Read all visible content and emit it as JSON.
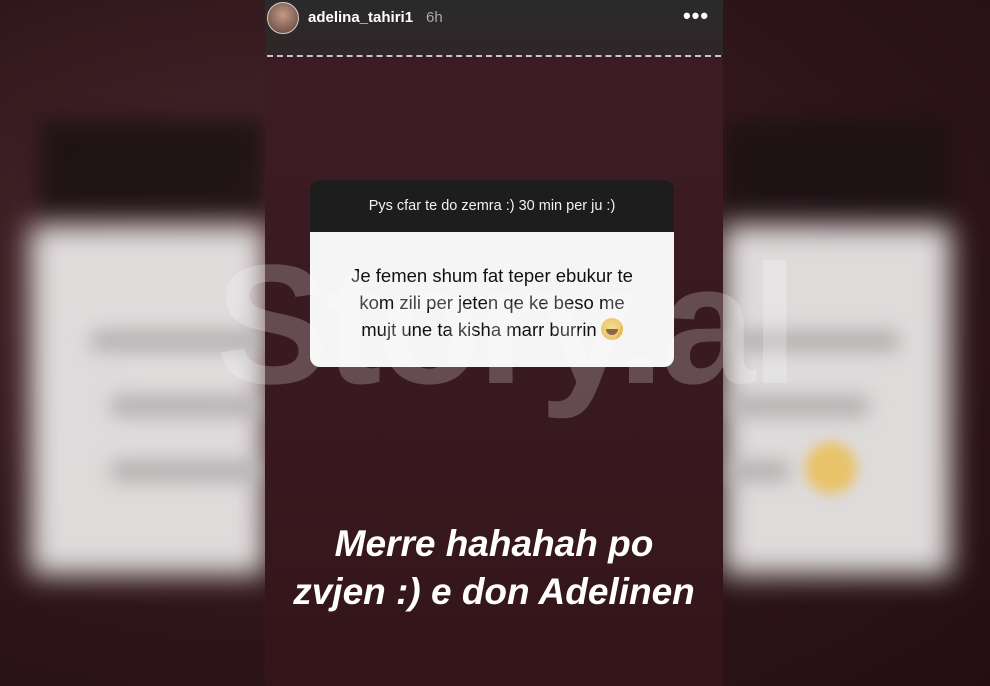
{
  "story": {
    "username": "adelina_tahiri1",
    "time": "6h",
    "more_label": "•••",
    "question": {
      "prompt": "Pys cfar te do zemra :) 30 min per ju :)",
      "answer_line1": "Je femen shum fat teper ebukur te",
      "answer_line2": "kom zili per jeten qe ke beso me",
      "answer_line3": "mujt une ta kisha marr burrin"
    },
    "reply_line1": "Merre hahahah po",
    "reply_line2": "zvjen :) e don Adelinen"
  },
  "watermark": "Story.al",
  "icons": {
    "more": "more-options-icon",
    "emoji": "laughing-emoji-icon"
  },
  "colors": {
    "story_bg": "#3a1a21",
    "question_header": "#1e1d1e",
    "question_body": "#f5f5f5"
  }
}
